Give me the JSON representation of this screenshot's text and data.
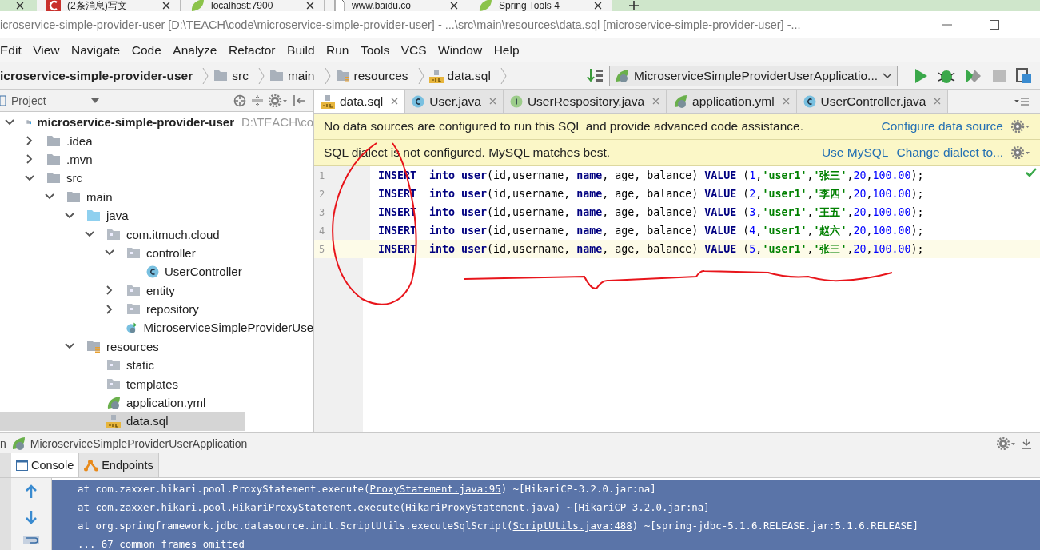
{
  "browser_tabs": [
    {
      "label": "(2条消息)写文",
      "kind": "csdn"
    },
    {
      "label": "localhost:7900",
      "kind": "leaf"
    },
    {
      "label": "www.baidu.co",
      "kind": "page"
    },
    {
      "label": "Spring Tools 4",
      "kind": "spring"
    }
  ],
  "window": {
    "title": "icroservice-simple-provider-user [D:\\TEACH\\code\\microservice-simple-provider-user] - ...\\src\\main\\resources\\data.sql [microservice-simple-provider-user] -..."
  },
  "menu": [
    "Edit",
    "View",
    "Navigate",
    "Code",
    "Analyze",
    "Refactor",
    "Build",
    "Run",
    "Tools",
    "VCS",
    "Window",
    "Help"
  ],
  "breadcrumbs": [
    {
      "label": "icroservice-simple-provider-user",
      "kind": "module"
    },
    {
      "label": "src",
      "kind": "folder"
    },
    {
      "label": "main",
      "kind": "folder"
    },
    {
      "label": "resources",
      "kind": "resources"
    },
    {
      "label": "data.sql",
      "kind": "sql"
    }
  ],
  "run_config": "MicroserviceSimpleProviderUserApplicatio...",
  "project_panel": {
    "title": "Project",
    "tree": [
      {
        "label": "microservice-simple-provider-user",
        "path": "D:\\TEACH\\co",
        "kind": "module",
        "expanded": true,
        "selected": false,
        "children": [
          {
            "label": ".idea",
            "kind": "folder",
            "expanded": false,
            "selected": false
          },
          {
            "label": ".mvn",
            "kind": "folder",
            "expanded": false,
            "selected": false
          },
          {
            "label": "src",
            "kind": "folder",
            "expanded": true,
            "selected": false,
            "children": [
              {
                "label": "main",
                "kind": "folder",
                "expanded": true,
                "selected": false,
                "children": [
                  {
                    "label": "java",
                    "kind": "source",
                    "expanded": true,
                    "selected": false,
                    "children": [
                      {
                        "label": "com.itmuch.cloud",
                        "kind": "package",
                        "expanded": true,
                        "selected": false,
                        "children": [
                          {
                            "label": "controller",
                            "kind": "package",
                            "expanded": true,
                            "selected": false,
                            "children": [
                              {
                                "label": "UserController",
                                "kind": "class",
                                "selected": false
                              }
                            ]
                          },
                          {
                            "label": "entity",
                            "kind": "package",
                            "expanded": false,
                            "selected": false
                          },
                          {
                            "label": "repository",
                            "kind": "package",
                            "expanded": false,
                            "selected": false
                          },
                          {
                            "label": "MicroserviceSimpleProviderUse",
                            "kind": "boot",
                            "selected": false
                          }
                        ]
                      }
                    ]
                  },
                  {
                    "label": "resources",
                    "kind": "resources",
                    "expanded": true,
                    "selected": false,
                    "children": [
                      {
                        "label": "static",
                        "kind": "package",
                        "selected": false
                      },
                      {
                        "label": "templates",
                        "kind": "package",
                        "selected": false
                      },
                      {
                        "label": "application.yml",
                        "kind": "yml",
                        "selected": false
                      },
                      {
                        "label": "data.sql",
                        "kind": "sql",
                        "selected": true
                      }
                    ]
                  }
                ]
              }
            ]
          }
        ]
      }
    ]
  },
  "editor_tabs": [
    {
      "label": "data.sql",
      "kind": "sql",
      "selected": true
    },
    {
      "label": "User.java",
      "kind": "class",
      "selected": false
    },
    {
      "label": "UserRespository.java",
      "kind": "interface",
      "selected": false
    },
    {
      "label": "application.yml",
      "kind": "yml",
      "selected": false
    },
    {
      "label": "UserController.java",
      "kind": "class",
      "selected": false
    }
  ],
  "banners": [
    {
      "message": "No data sources are configured to run this SQL and provide advanced code assistance.",
      "links": [
        "Configure data source"
      ]
    },
    {
      "message": "SQL dialect is not configured. MySQL matches best.",
      "links": [
        "Use MySQL",
        "Change dialect to..."
      ]
    }
  ],
  "code_lines": [
    {
      "number": "1",
      "current": false,
      "tokens": [
        {
          "kind": "kw",
          "text": "INSERT  into user"
        },
        {
          "kind": "text",
          "text": "(id,username, "
        },
        {
          "kind": "kw",
          "text": "name"
        },
        {
          "kind": "text",
          "text": ", age, balance) "
        },
        {
          "kind": "kw",
          "text": "VALUE"
        },
        {
          "kind": "text",
          "text": " ("
        },
        {
          "kind": "num",
          "text": "1"
        },
        {
          "kind": "text",
          "text": ","
        },
        {
          "kind": "str",
          "text": "'user1'"
        },
        {
          "kind": "text",
          "text": ","
        },
        {
          "kind": "str",
          "text": "'张三'"
        },
        {
          "kind": "text",
          "text": ","
        },
        {
          "kind": "num",
          "text": "20"
        },
        {
          "kind": "text",
          "text": ","
        },
        {
          "kind": "num",
          "text": "100.00"
        },
        {
          "kind": "text",
          "text": ");"
        }
      ]
    },
    {
      "number": "2",
      "current": false,
      "tokens": [
        {
          "kind": "kw",
          "text": "INSERT  into user"
        },
        {
          "kind": "text",
          "text": "(id,username, "
        },
        {
          "kind": "kw",
          "text": "name"
        },
        {
          "kind": "text",
          "text": ", age, balance) "
        },
        {
          "kind": "kw",
          "text": "VALUE"
        },
        {
          "kind": "text",
          "text": " ("
        },
        {
          "kind": "num",
          "text": "2"
        },
        {
          "kind": "text",
          "text": ","
        },
        {
          "kind": "str",
          "text": "'user1'"
        },
        {
          "kind": "text",
          "text": ","
        },
        {
          "kind": "str",
          "text": "'李四'"
        },
        {
          "kind": "text",
          "text": ","
        },
        {
          "kind": "num",
          "text": "20"
        },
        {
          "kind": "text",
          "text": ","
        },
        {
          "kind": "num",
          "text": "100.00"
        },
        {
          "kind": "text",
          "text": ");"
        }
      ]
    },
    {
      "number": "3",
      "current": false,
      "tokens": [
        {
          "kind": "kw",
          "text": "INSERT  into user"
        },
        {
          "kind": "text",
          "text": "(id,username, "
        },
        {
          "kind": "kw",
          "text": "name"
        },
        {
          "kind": "text",
          "text": ", age, balance) "
        },
        {
          "kind": "kw",
          "text": "VALUE"
        },
        {
          "kind": "text",
          "text": " ("
        },
        {
          "kind": "num",
          "text": "3"
        },
        {
          "kind": "text",
          "text": ","
        },
        {
          "kind": "str",
          "text": "'user1'"
        },
        {
          "kind": "text",
          "text": ","
        },
        {
          "kind": "str",
          "text": "'王五'"
        },
        {
          "kind": "text",
          "text": ","
        },
        {
          "kind": "num",
          "text": "20"
        },
        {
          "kind": "text",
          "text": ","
        },
        {
          "kind": "num",
          "text": "100.00"
        },
        {
          "kind": "text",
          "text": ");"
        }
      ]
    },
    {
      "number": "4",
      "current": false,
      "tokens": [
        {
          "kind": "kw",
          "text": "INSERT  into user"
        },
        {
          "kind": "text",
          "text": "(id,username, "
        },
        {
          "kind": "kw",
          "text": "name"
        },
        {
          "kind": "text",
          "text": ", age, balance) "
        },
        {
          "kind": "kw",
          "text": "VALUE"
        },
        {
          "kind": "text",
          "text": " ("
        },
        {
          "kind": "num",
          "text": "4"
        },
        {
          "kind": "text",
          "text": ","
        },
        {
          "kind": "str",
          "text": "'user1'"
        },
        {
          "kind": "text",
          "text": ","
        },
        {
          "kind": "str",
          "text": "'赵六'"
        },
        {
          "kind": "text",
          "text": ","
        },
        {
          "kind": "num",
          "text": "20"
        },
        {
          "kind": "text",
          "text": ","
        },
        {
          "kind": "num",
          "text": "100.00"
        },
        {
          "kind": "text",
          "text": ");"
        }
      ]
    },
    {
      "number": "5",
      "current": true,
      "tokens": [
        {
          "kind": "kw",
          "text": "INSERT  into user"
        },
        {
          "kind": "text",
          "text": "(id,username, "
        },
        {
          "kind": "kw",
          "text": "name"
        },
        {
          "kind": "text",
          "text": ", age, balance) "
        },
        {
          "kind": "kw",
          "text": "VALUE"
        },
        {
          "kind": "text",
          "text": " ("
        },
        {
          "kind": "num",
          "text": "5"
        },
        {
          "kind": "text",
          "text": ","
        },
        {
          "kind": "str",
          "text": "'user1'"
        },
        {
          "kind": "text",
          "text": ","
        },
        {
          "kind": "str",
          "text": "'张三'"
        },
        {
          "kind": "text",
          "text": ","
        },
        {
          "kind": "num",
          "text": "20"
        },
        {
          "kind": "text",
          "text": ","
        },
        {
          "kind": "num",
          "text": "100.00"
        },
        {
          "kind": "text",
          "text": ");"
        }
      ]
    }
  ],
  "run_panel": {
    "label_fragment": "n",
    "title": "MicroserviceSimpleProviderUserApplication",
    "tabs": [
      {
        "label": "Console",
        "kind": "console",
        "selected": true
      },
      {
        "label": "Endpoints",
        "kind": "endpoints",
        "selected": false
      }
    ],
    "console_lines": [
      {
        "selected": true,
        "parts": [
          {
            "kind": "text",
            "text": "at com.zaxxer.hikari.pool.ProxyStatement.execute("
          },
          {
            "kind": "link",
            "text": "ProxyStatement.java:95"
          },
          {
            "kind": "text",
            "text": ") ~[HikariCP-3.2.0.jar:na]"
          }
        ]
      },
      {
        "selected": true,
        "parts": [
          {
            "kind": "text",
            "text": "at com.zaxxer.hikari.pool.HikariProxyStatement.execute(HikariProxyStatement.java) ~[HikariCP-3.2.0.jar:na]"
          }
        ]
      },
      {
        "selected": true,
        "parts": [
          {
            "kind": "text",
            "text": "at org.springframework.jdbc.datasource.init.ScriptUtils.executeSqlScript("
          },
          {
            "kind": "link",
            "text": "ScriptUtils.java:488"
          },
          {
            "kind": "text",
            "text": ") ~[spring-jdbc-5.1.6.RELEASE.jar:5.1.6.RELEASE]"
          }
        ]
      },
      {
        "selected": true,
        "parts": [
          {
            "kind": "text",
            "text": "... 67 common frames omitted"
          }
        ]
      }
    ]
  }
}
